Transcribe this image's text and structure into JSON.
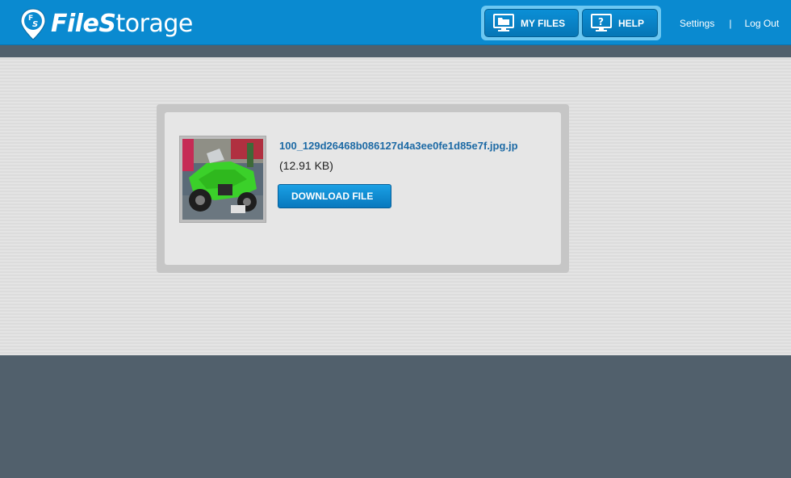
{
  "header": {
    "logo": {
      "bold": "File",
      "bold2": "S",
      "rest": "torage",
      "pin_letters": "FS"
    },
    "nav": [
      {
        "label": "MY FILES",
        "icon": "monitor-folder-icon"
      },
      {
        "label": "HELP",
        "icon": "monitor-question-icon"
      }
    ],
    "links": {
      "settings": "Settings",
      "separator": "|",
      "logout": "Log Out"
    }
  },
  "file": {
    "name": "100_129d26468b086127d4a3ee0fe1d85e7f.jpg.jp",
    "size": "(12.91 KB)",
    "download_label": "DOWNLOAD FILE"
  },
  "colors": {
    "header": "#0a8ad0",
    "nav_group": "#6cc8f2",
    "link": "#1d6aa5",
    "footer": "#51606c"
  }
}
